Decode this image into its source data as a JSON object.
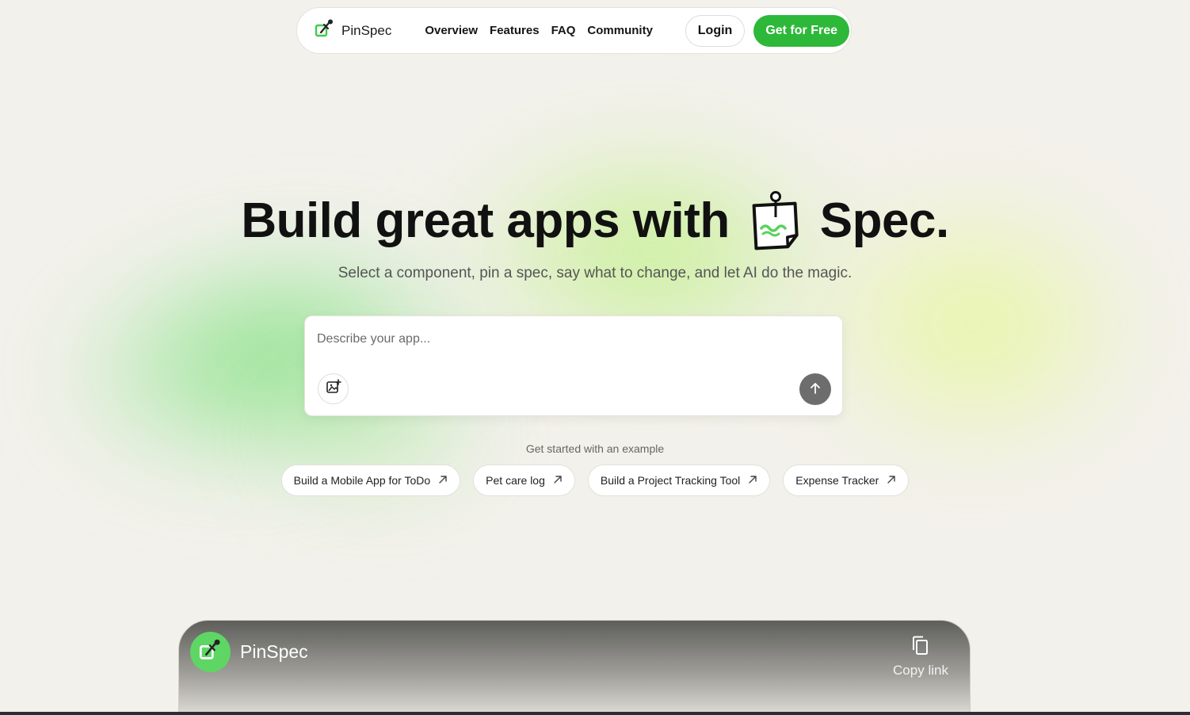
{
  "nav": {
    "brand": "PinSpec",
    "links": [
      "Overview",
      "Features",
      "FAQ",
      "Community"
    ],
    "login_label": "Login",
    "cta_label": "Get for Free"
  },
  "hero": {
    "title_before": "Build great apps with",
    "title_after": "Spec.",
    "subtitle": "Select a component, pin a spec, say what to change, and let AI do the magic."
  },
  "prompt": {
    "placeholder": "Describe your app..."
  },
  "examples": {
    "label": "Get started with an example",
    "items": [
      "Build a Mobile App for ToDo",
      "Pet care log",
      "Build a Project Tracking Tool",
      "Expense Tracker"
    ]
  },
  "video": {
    "title": "PinSpec",
    "copy_label": "Copy link"
  },
  "colors": {
    "accent": "#2db839",
    "background": "#f3f1ec"
  }
}
